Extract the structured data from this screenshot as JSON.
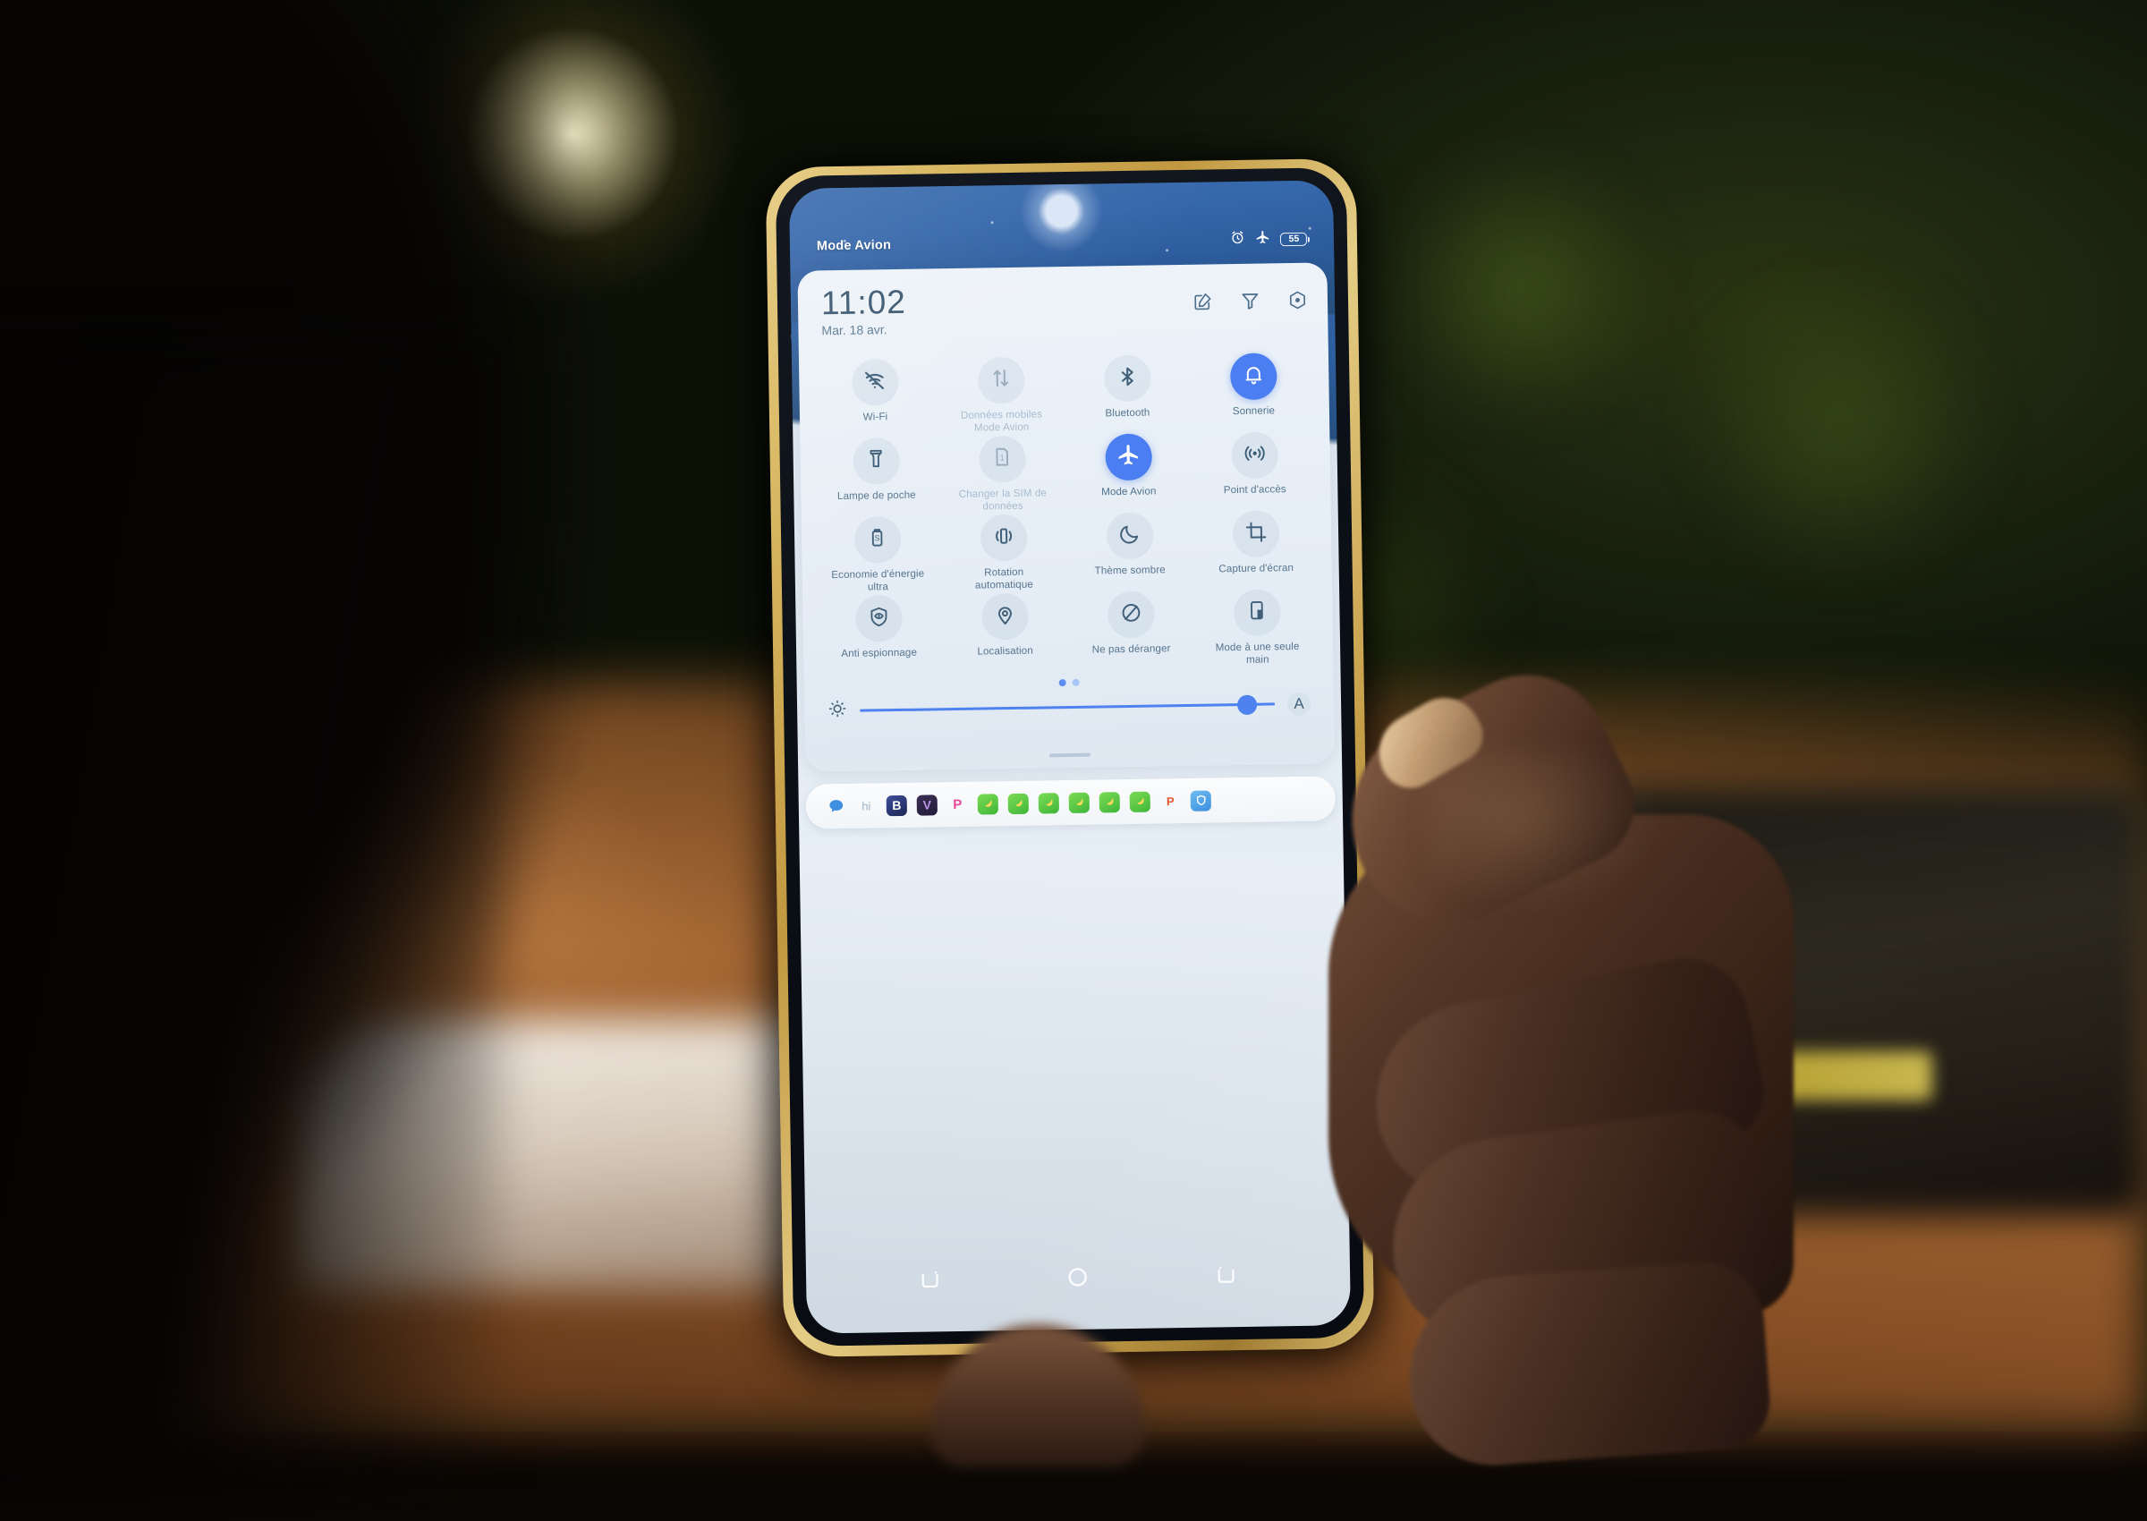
{
  "statusbar": {
    "label": "Mode Avion",
    "alarm_icon": "alarm-clock-icon",
    "airplane_icon": "airplane-icon",
    "battery_level": "55"
  },
  "quick_settings": {
    "time": "11:02",
    "date": "Mar. 18 avr.",
    "actions": [
      {
        "name": "edit-icon",
        "label": "Modifier"
      },
      {
        "name": "filter-icon",
        "label": "Filtrer"
      },
      {
        "name": "settings-icon",
        "label": "Paramètres"
      }
    ],
    "tiles": [
      {
        "label": "Wi-Fi",
        "icon": "wifi-off-icon",
        "state": "off"
      },
      {
        "label": "Données mobiles",
        "sublabel": "Mode Avion",
        "icon": "mobile-data-icon",
        "state": "disabled"
      },
      {
        "label": "Bluetooth",
        "icon": "bluetooth-icon",
        "state": "off"
      },
      {
        "label": "Sonnerie",
        "icon": "bell-icon",
        "state": "active"
      },
      {
        "label": "Lampe de poche",
        "icon": "flashlight-icon",
        "state": "off"
      },
      {
        "label": "Changer la SIM de données",
        "icon": "sim-card-icon",
        "state": "disabled"
      },
      {
        "label": "Mode Avion",
        "icon": "airplane-icon",
        "state": "active"
      },
      {
        "label": "Point d'accès",
        "icon": "hotspot-icon",
        "state": "off"
      },
      {
        "label": "Economie d'énergie ultra",
        "icon": "battery-saver-icon",
        "state": "off"
      },
      {
        "label": "Rotation automatique",
        "icon": "auto-rotate-icon",
        "state": "off"
      },
      {
        "label": "Thème sombre",
        "icon": "moon-icon",
        "state": "off"
      },
      {
        "label": "Capture d'écran",
        "icon": "screenshot-crop-icon",
        "state": "off"
      },
      {
        "label": "Anti espionnage",
        "icon": "shield-eye-icon",
        "state": "off"
      },
      {
        "label": "Localisation",
        "icon": "location-pin-icon",
        "state": "off"
      },
      {
        "label": "Ne pas déranger",
        "icon": "do-not-disturb-icon",
        "state": "off"
      },
      {
        "label": "Mode à une seule main",
        "icon": "one-handed-mode-icon",
        "state": "off"
      }
    ],
    "page_dots": {
      "count": 2,
      "active_index": 0
    },
    "brightness": {
      "icon": "brightness-sun-icon",
      "value_percent": 92,
      "auto_label": "A"
    }
  },
  "notifications": {
    "apps": [
      {
        "name": "message-bubble-icon",
        "glyph": "",
        "color": "#3f8fe0",
        "type": "plain"
      },
      {
        "name": "hi-app-icon",
        "glyph": "hi",
        "color": "#a8bfd0",
        "type": "plain"
      },
      {
        "name": "b-app-icon",
        "glyph": "B",
        "color": "#2a3a7a",
        "type": "tile"
      },
      {
        "name": "v-app-icon",
        "glyph": "V",
        "color": "#2b2344",
        "type": "tile"
      },
      {
        "name": "p-app-icon",
        "glyph": "P",
        "color": "#e8489a",
        "type": "plain"
      },
      {
        "name": "green-app-icon",
        "glyph": "",
        "color": "#58c84a",
        "type": "tile"
      },
      {
        "name": "green-app-icon",
        "glyph": "",
        "color": "#58c84a",
        "type": "tile"
      },
      {
        "name": "green-app-icon",
        "glyph": "",
        "color": "#58c84a",
        "type": "tile"
      },
      {
        "name": "green-app-icon",
        "glyph": "",
        "color": "#58c84a",
        "type": "tile"
      },
      {
        "name": "green-app-icon",
        "glyph": "",
        "color": "#58c84a",
        "type": "tile"
      },
      {
        "name": "green-app-icon",
        "glyph": "",
        "color": "#58c84a",
        "type": "tile"
      },
      {
        "name": "orange-app-icon",
        "glyph": "P",
        "color": "#e2572c",
        "type": "tile"
      },
      {
        "name": "security-shield-app-icon",
        "glyph": "",
        "color": "#4b9fe8",
        "type": "tile"
      }
    ]
  },
  "navbar": {
    "buttons": [
      {
        "name": "recents-button",
        "label": "Récents"
      },
      {
        "name": "home-button",
        "label": "Accueil"
      },
      {
        "name": "back-button",
        "label": "Retour"
      }
    ]
  },
  "theme": {
    "accent": "#4b7ef1",
    "panel_bg": "#e9f0f7",
    "label_color": "#56748e",
    "wallpaper_blue": "#3567ab",
    "frame_gold": "#d9b964"
  }
}
